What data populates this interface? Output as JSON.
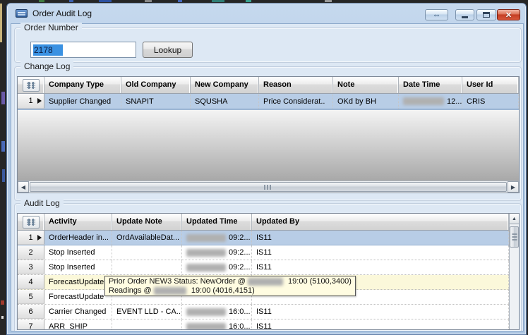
{
  "window": {
    "title": "Order Audit Log"
  },
  "order_number": {
    "label": "Order Number",
    "value": "2178",
    "lookup": "Lookup"
  },
  "change_log": {
    "label": "Change Log",
    "columns": [
      "Company Type",
      "Old Company",
      "New Company",
      "Reason",
      "Note",
      "Date Time",
      "User Id"
    ],
    "rows": [
      {
        "num": "1",
        "company_type": "Supplier Changed",
        "old_company": "SNAPIT",
        "new_company": "SQUSHA",
        "reason": "Price Considerat..",
        "note": "OKd by BH",
        "date_time": "12...",
        "user_id": "CRIS"
      }
    ]
  },
  "audit_log": {
    "label": "Audit Log",
    "columns": [
      "Activity",
      "Update Note",
      "Updated Time",
      "Updated By"
    ],
    "rows": [
      {
        "num": "1",
        "activity": "OrderHeader in...",
        "update_note": "OrdAvailableDat...",
        "updated_time": "09:2...",
        "updated_by": "IS11"
      },
      {
        "num": "2",
        "activity": "Stop Inserted",
        "update_note": "",
        "updated_time": "09:2...",
        "updated_by": "IS11"
      },
      {
        "num": "3",
        "activity": "Stop Inserted",
        "update_note": "",
        "updated_time": "09:2...",
        "updated_by": "IS11"
      },
      {
        "num": "4",
        "activity": "ForecastUpdate",
        "update_note": "",
        "updated_time": "",
        "updated_by": ""
      },
      {
        "num": "5",
        "activity": "ForecastUpdate",
        "update_note": "",
        "updated_time": "",
        "updated_by": ""
      },
      {
        "num": "6",
        "activity": "Carrier Changed",
        "update_note": "EVENT LLD - CA...",
        "updated_time": "16:0...",
        "updated_by": "IS11"
      },
      {
        "num": "7",
        "activity": "ARR_SHIP",
        "update_note": "",
        "updated_time": "16:0...",
        "updated_by": "IS11"
      }
    ]
  },
  "tooltip": {
    "line1_pre": "Prior Order NEW3 Status: NewOrder @ ",
    "line1_post": " 19:00 (5100,3400)",
    "line2_pre": "Readings @ ",
    "line2_post": " 19:00 (4016,4151)"
  },
  "colors": {
    "frame": "#b3cbe6",
    "client_bg": "#dde8f4",
    "selected_row": "#b8cde6",
    "hover_row": "#fbf8da",
    "selection": "#3a91e2",
    "tooltip_bg": "#fffce1",
    "close_red": "#c23c22"
  }
}
